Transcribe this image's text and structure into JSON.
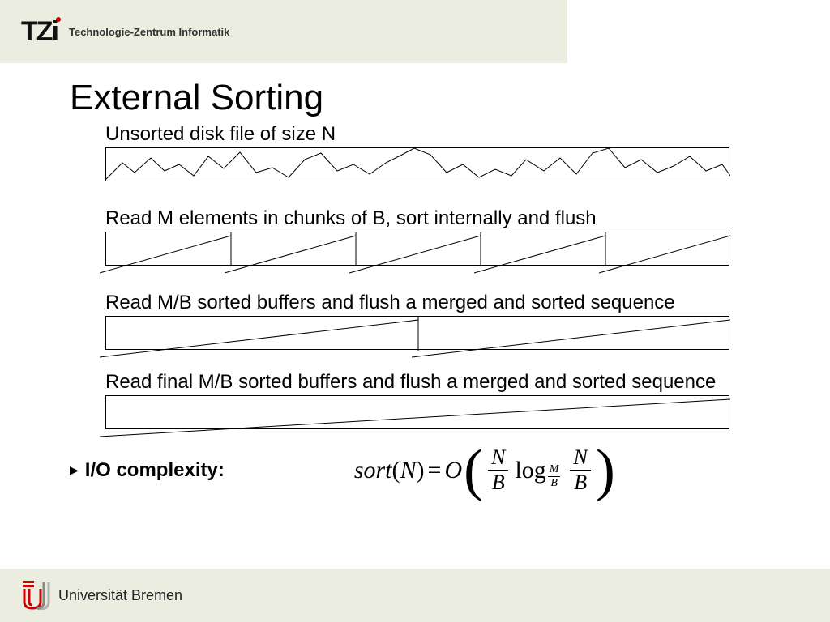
{
  "header": {
    "logo_text": "TZi",
    "subtitle": "Technologie-Zentrum Informatik"
  },
  "footer": {
    "university": "Universität Bremen"
  },
  "slide": {
    "title": "External Sorting",
    "stage1_label": "Unsorted disk file of size N",
    "stage2_label": "Read M elements in chunks of B, sort internally and flush",
    "stage3_label": "Read M/B sorted buffers and flush a merged and sorted sequence",
    "stage4_label": "Read final M/B sorted buffers and flush a merged and sorted sequence",
    "complexity_label": "I/O complexity:",
    "formula": {
      "lhs": "sort",
      "arg": "N",
      "eq": "=",
      "bigO": "O",
      "frac1_num": "N",
      "frac1_den": "B",
      "log": "log",
      "logbase_num": "M",
      "logbase_den": "B",
      "frac2_num": "N",
      "frac2_den": "B"
    }
  }
}
